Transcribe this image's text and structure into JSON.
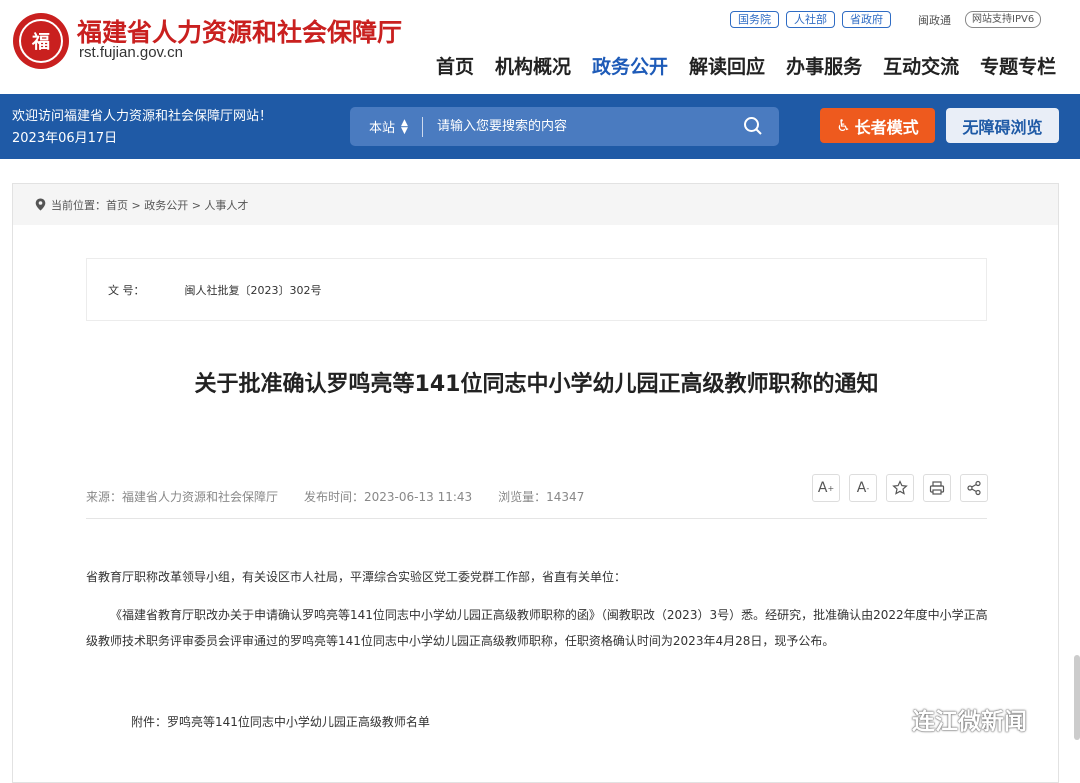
{
  "header": {
    "site_name": "福建省人力资源和社会保障厅",
    "domain": "rst.fujian.gov.cn",
    "emblem_text": "福",
    "top_links": [
      "国务院",
      "人社部",
      "省政府"
    ],
    "minzhengtong": "闽政通",
    "ipv6": "网站支持IPV6",
    "nav": [
      "首页",
      "机构概况",
      "政务公开",
      "解读回应",
      "办事服务",
      "互动交流",
      "专题专栏"
    ],
    "nav_active_index": 2
  },
  "banner": {
    "welcome": "欢迎访问福建省人力资源和社会保障厅网站！",
    "date": "2023年06月17日",
    "search_scope": "本站",
    "search_placeholder": "请输入您要搜索的内容",
    "elder_mode": "长者模式",
    "accessible": "无障碍浏览"
  },
  "article": {
    "breadcrumb": "当前位置：首页 > 政务公开 > 人事人才",
    "doc_no_label": "文 号：",
    "doc_no": "闽人社批复〔2023〕302号",
    "title": "关于批准确认罗鸣亮等141位同志中小学幼儿园正高级教师职称的通知",
    "source": "来源：福建省人力资源和社会保障厅",
    "publish_time": "发布时间：2023-06-13 11:43",
    "views": "浏览量：14347",
    "tools": {
      "font_up": "A",
      "font_down": "A"
    },
    "para1": "省教育厅职称改革领导小组，有关设区市人社局，平潭综合实验区党工委党群工作部，省直有关单位：",
    "para2": "《福建省教育厅职改办关于申请确认罗鸣亮等141位同志中小学幼儿园正高级教师职称的函》（闽教职改（2023）3号）悉。经研究，批准确认由2022年度中小学正高级教师技术职务评审委员会评审通过的罗鸣亮等141位同志中小学幼儿园正高级教师职称，任职资格确认时间为2023年4月28日，现予公布。",
    "attachment": "附件：罗鸣亮等141位同志中小学幼儿园正高级教师名单"
  },
  "watermark": "连江微新闻",
  "colors": {
    "brand_red": "#c9201f",
    "brand_blue": "#1f5aa6",
    "nav_active": "#1e5bb8",
    "elder_orange": "#ee5a1e"
  }
}
